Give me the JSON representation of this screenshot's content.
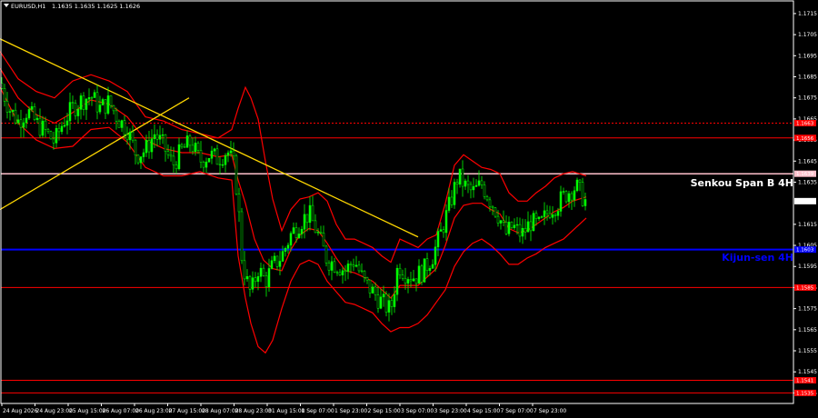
{
  "header": {
    "symbol": "EURUSD,H1",
    "ohlc": "1.1635 1.1635 1.1625 1.1626"
  },
  "colors": {
    "background": "#000000",
    "frame": "#ffffff",
    "bull_candle": "#00ff00",
    "bear_candle": "#000000",
    "candle_wick": "#00ff00",
    "ichimoku": "#ff0000",
    "trendline": "#ffd700",
    "kijun_line": "#0000ff",
    "senkou_line": "#ffc0cb",
    "support_resistance": "#ff0000",
    "current_price_tag": "#ffffff"
  },
  "labels": {
    "senkou": "Senkou Span B 4H",
    "kijun": "Kijun-sen 4H"
  },
  "chart_data": {
    "type": "candlestick",
    "title": "",
    "xlabel": "",
    "ylabel": "",
    "ylim": [
      1.153,
      1.1721
    ],
    "y_ticks": [
      "1.1715",
      "1.1705",
      "1.1695",
      "1.1685",
      "1.1675",
      "1.1665",
      "1.1655",
      "1.1645",
      "1.1635",
      "1.1615",
      "1.1605",
      "1.1595",
      "1.1585",
      "1.1575",
      "1.1565",
      "1.1555",
      "1.1545",
      "1.1535"
    ],
    "x_ticks": [
      "24 Aug 2026",
      "24 Aug 23:00",
      "25 Aug 15:00",
      "26 Aug 07:00",
      "26 Aug 23:00",
      "27 Aug 15:00",
      "28 Aug 07:00",
      "28 Aug 23:00",
      "31 Aug 15:00",
      "1 Sep 07:00",
      "1 Sep 23:00",
      "2 Sep 15:00",
      "3 Sep 07:00",
      "3 Sep 23:00",
      "4 Sep 15:00",
      "7 Sep 07:00",
      "7 Sep 23:00"
    ],
    "levels": [
      {
        "name": "resistance-1",
        "price": 1.1663,
        "tag": "1.1663",
        "style": "dashed"
      },
      {
        "name": "resistance-2",
        "price": 1.1656,
        "tag": "1.1656",
        "style": "solid"
      },
      {
        "name": "senkou-span-b-4h",
        "price": 1.1639,
        "tag": "1.1639",
        "style": "solid-pink"
      },
      {
        "name": "kijun-sen-4h",
        "price": 1.1603,
        "tag": "1.1603",
        "style": "solid-blue"
      },
      {
        "name": "support-1",
        "price": 1.1585,
        "tag": "1.1585",
        "style": "solid"
      },
      {
        "name": "support-2",
        "price": 1.1541,
        "tag": "1.1541",
        "style": "solid"
      },
      {
        "name": "support-3",
        "price": 1.1535,
        "tag": "1.1535",
        "style": "solid"
      }
    ],
    "current_price": {
      "price": 1.1626,
      "tag": "1.1626"
    },
    "trendlines": [
      {
        "name": "descending-trendline",
        "from": [
          0,
          1.1703
        ],
        "to": [
          460,
          1.1609
        ]
      },
      {
        "name": "ascending-trendline",
        "from": [
          0,
          1.1622
        ],
        "to": [
          208,
          1.1675
        ]
      }
    ],
    "close_path": [
      [
        0,
        1.1682
      ],
      [
        10,
        1.167
      ],
      [
        20,
        1.1664
      ],
      [
        30,
        1.1669
      ],
      [
        40,
        1.1663
      ],
      [
        50,
        1.1659
      ],
      [
        60,
        1.1654
      ],
      [
        70,
        1.1664
      ],
      [
        80,
        1.167
      ],
      [
        90,
        1.1674
      ],
      [
        100,
        1.1676
      ],
      [
        110,
        1.167
      ],
      [
        120,
        1.1673
      ],
      [
        130,
        1.1665
      ],
      [
        140,
        1.166
      ],
      [
        150,
        1.1648
      ],
      [
        160,
        1.165
      ],
      [
        170,
        1.1658
      ],
      [
        180,
        1.1652
      ],
      [
        190,
        1.1643
      ],
      [
        200,
        1.165
      ],
      [
        210,
        1.1654
      ],
      [
        220,
        1.1645
      ],
      [
        230,
        1.1648
      ],
      [
        240,
        1.1646
      ],
      [
        250,
        1.165
      ],
      [
        258,
        1.1642
      ],
      [
        262,
        1.1625
      ],
      [
        266,
        1.16
      ],
      [
        270,
        1.159
      ],
      [
        276,
        1.1582
      ],
      [
        284,
        1.1594
      ],
      [
        292,
        1.1588
      ],
      [
        300,
        1.1595
      ],
      [
        310,
        1.16
      ],
      [
        320,
        1.161
      ],
      [
        330,
        1.1616
      ],
      [
        340,
        1.162
      ],
      [
        350,
        1.161
      ],
      [
        360,
        1.1598
      ],
      [
        370,
        1.1596
      ],
      [
        380,
        1.1593
      ],
      [
        390,
        1.1598
      ],
      [
        400,
        1.1588
      ],
      [
        410,
        1.1583
      ],
      [
        420,
        1.1578
      ],
      [
        430,
        1.1574
      ],
      [
        438,
        1.1596
      ],
      [
        446,
        1.1592
      ],
      [
        456,
        1.159
      ],
      [
        466,
        1.1593
      ],
      [
        476,
        1.16
      ],
      [
        486,
        1.1612
      ],
      [
        496,
        1.1626
      ],
      [
        504,
        1.1638
      ],
      [
        512,
        1.1633
      ],
      [
        520,
        1.163
      ],
      [
        530,
        1.1634
      ],
      [
        540,
        1.1626
      ],
      [
        550,
        1.1618
      ],
      [
        556,
        1.161
      ],
      [
        564,
        1.1614
      ],
      [
        574,
        1.161
      ],
      [
        584,
        1.1616
      ],
      [
        594,
        1.1614
      ],
      [
        604,
        1.1622
      ],
      [
        614,
        1.1625
      ],
      [
        624,
        1.163
      ],
      [
        634,
        1.1633
      ],
      [
        644,
        1.1626
      ]
    ],
    "bollinger_upper": [
      [
        0,
        1.1697
      ],
      [
        20,
        1.1684
      ],
      [
        40,
        1.1678
      ],
      [
        60,
        1.1675
      ],
      [
        80,
        1.1683
      ],
      [
        100,
        1.1686
      ],
      [
        120,
        1.1683
      ],
      [
        140,
        1.1678
      ],
      [
        160,
        1.1666
      ],
      [
        180,
        1.1664
      ],
      [
        200,
        1.166
      ],
      [
        220,
        1.1658
      ],
      [
        240,
        1.1656
      ],
      [
        255,
        1.166
      ],
      [
        262,
        1.167
      ],
      [
        270,
        1.168
      ],
      [
        276,
        1.1675
      ],
      [
        284,
        1.1665
      ],
      [
        292,
        1.1645
      ],
      [
        300,
        1.1627
      ],
      [
        310,
        1.1612
      ],
      [
        320,
        1.1622
      ],
      [
        330,
        1.1627
      ],
      [
        340,
        1.1628
      ],
      [
        350,
        1.163
      ],
      [
        360,
        1.1626
      ],
      [
        370,
        1.1615
      ],
      [
        380,
        1.1608
      ],
      [
        390,
        1.1608
      ],
      [
        400,
        1.1606
      ],
      [
        410,
        1.1604
      ],
      [
        420,
        1.16
      ],
      [
        430,
        1.1597
      ],
      [
        440,
        1.1608
      ],
      [
        450,
        1.1606
      ],
      [
        460,
        1.1604
      ],
      [
        470,
        1.1608
      ],
      [
        480,
        1.161
      ],
      [
        490,
        1.1625
      ],
      [
        500,
        1.1643
      ],
      [
        510,
        1.1648
      ],
      [
        520,
        1.1645
      ],
      [
        530,
        1.1642
      ],
      [
        540,
        1.1641
      ],
      [
        550,
        1.1639
      ],
      [
        560,
        1.163
      ],
      [
        570,
        1.1626
      ],
      [
        580,
        1.1626
      ],
      [
        590,
        1.163
      ],
      [
        600,
        1.1633
      ],
      [
        610,
        1.1637
      ],
      [
        620,
        1.1639
      ],
      [
        630,
        1.164
      ],
      [
        645,
        1.1638
      ]
    ],
    "bollinger_lower": [
      [
        0,
        1.168
      ],
      [
        20,
        1.1663
      ],
      [
        40,
        1.1655
      ],
      [
        60,
        1.1651
      ],
      [
        80,
        1.1652
      ],
      [
        100,
        1.166
      ],
      [
        120,
        1.1661
      ],
      [
        140,
        1.1654
      ],
      [
        160,
        1.1642
      ],
      [
        180,
        1.1638
      ],
      [
        200,
        1.1638
      ],
      [
        220,
        1.164
      ],
      [
        240,
        1.1637
      ],
      [
        255,
        1.1636
      ],
      [
        262,
        1.16
      ],
      [
        270,
        1.158
      ],
      [
        276,
        1.1568
      ],
      [
        284,
        1.1557
      ],
      [
        292,
        1.1554
      ],
      [
        300,
        1.156
      ],
      [
        310,
        1.1575
      ],
      [
        320,
        1.1588
      ],
      [
        330,
        1.1596
      ],
      [
        340,
        1.1598
      ],
      [
        350,
        1.1596
      ],
      [
        360,
        1.1588
      ],
      [
        370,
        1.1583
      ],
      [
        380,
        1.1578
      ],
      [
        390,
        1.1577
      ],
      [
        400,
        1.1575
      ],
      [
        410,
        1.1573
      ],
      [
        420,
        1.1568
      ],
      [
        430,
        1.1564
      ],
      [
        440,
        1.1566
      ],
      [
        450,
        1.1566
      ],
      [
        460,
        1.1568
      ],
      [
        470,
        1.1572
      ],
      [
        480,
        1.1578
      ],
      [
        490,
        1.1584
      ],
      [
        500,
        1.1595
      ],
      [
        510,
        1.1602
      ],
      [
        520,
        1.1606
      ],
      [
        530,
        1.1608
      ],
      [
        540,
        1.1605
      ],
      [
        550,
        1.1601
      ],
      [
        560,
        1.1596
      ],
      [
        570,
        1.1596
      ],
      [
        580,
        1.1599
      ],
      [
        590,
        1.1601
      ],
      [
        600,
        1.1604
      ],
      [
        610,
        1.1606
      ],
      [
        620,
        1.1608
      ],
      [
        630,
        1.1612
      ],
      [
        645,
        1.1618
      ]
    ],
    "ichimoku_middle": [
      [
        0,
        1.1689
      ],
      [
        20,
        1.1675
      ],
      [
        40,
        1.1667
      ],
      [
        60,
        1.1663
      ],
      [
        80,
        1.1668
      ],
      [
        100,
        1.1674
      ],
      [
        120,
        1.1672
      ],
      [
        140,
        1.1666
      ],
      [
        160,
        1.1655
      ],
      [
        180,
        1.1651
      ],
      [
        200,
        1.1649
      ],
      [
        220,
        1.1649
      ],
      [
        240,
        1.1647
      ],
      [
        255,
        1.1648
      ],
      [
        262,
        1.1636
      ],
      [
        270,
        1.1625
      ],
      [
        280,
        1.1608
      ],
      [
        290,
        1.1598
      ],
      [
        300,
        1.1594
      ],
      [
        310,
        1.1593
      ],
      [
        320,
        1.1603
      ],
      [
        330,
        1.161
      ],
      [
        340,
        1.1613
      ],
      [
        350,
        1.1612
      ],
      [
        360,
        1.1606
      ],
      [
        370,
        1.1599
      ],
      [
        380,
        1.1593
      ],
      [
        390,
        1.1592
      ],
      [
        400,
        1.159
      ],
      [
        410,
        1.1588
      ],
      [
        420,
        1.1584
      ],
      [
        430,
        1.158
      ],
      [
        440,
        1.1586
      ],
      [
        450,
        1.1586
      ],
      [
        460,
        1.1586
      ],
      [
        470,
        1.159
      ],
      [
        480,
        1.1594
      ],
      [
        490,
        1.1605
      ],
      [
        500,
        1.1618
      ],
      [
        510,
        1.1624
      ],
      [
        520,
        1.1625
      ],
      [
        530,
        1.1625
      ],
      [
        540,
        1.1622
      ],
      [
        550,
        1.162
      ],
      [
        560,
        1.1613
      ],
      [
        570,
        1.1611
      ],
      [
        580,
        1.1612
      ],
      [
        590,
        1.1615
      ],
      [
        600,
        1.1618
      ],
      [
        610,
        1.1621
      ],
      [
        620,
        1.1623
      ],
      [
        630,
        1.1626
      ],
      [
        645,
        1.1628
      ]
    ]
  }
}
